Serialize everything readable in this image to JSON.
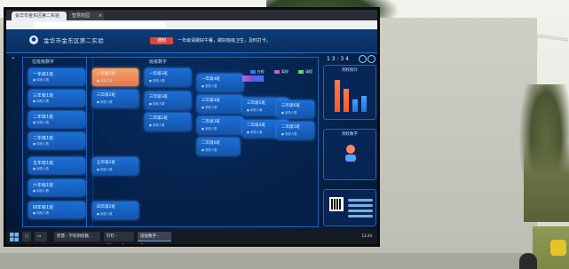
{
  "browser": {
    "tabs": [
      {
        "label": "会华市金东区第二实验学校"
      },
      {
        "label": "智慧校园"
      }
    ]
  },
  "dashboard": {
    "school_name": "金华市金东区第二实验",
    "notice_badge": "通知",
    "notice_text": "一年级请做好午餐，做好班级卫生，及时打卡。",
    "left_panel_title": "在班级数字",
    "center_panel_title": "班级数字",
    "legend": [
      {
        "label": "在校",
        "color": "#2b7bff"
      },
      {
        "label": "离校",
        "color": "#c65fd6"
      },
      {
        "label": "请假",
        "color": "#5fd67a"
      }
    ],
    "time_readout": "1 3 : 3 4",
    "stats_title": "到校统计",
    "rate_title": "到校数字",
    "left_tiles": [
      {
        "title": "一年级1班",
        "sub": "● 到校人数"
      },
      {
        "title": "三年级1班",
        "sub": "● 到校人数"
      },
      {
        "title": "二年级1班",
        "sub": "● 到校人数"
      },
      {
        "title": "二年级1班",
        "sub": "● 到校人数"
      },
      {
        "title": "五年级1班",
        "sub": "● 到校人数"
      },
      {
        "title": "六年级1班",
        "sub": "● 到校人数"
      },
      {
        "title": "四年级1班",
        "sub": "● 到校人数"
      }
    ],
    "grid_tiles": [
      {
        "title": "一年级2班",
        "sub": "● 到校人数"
      },
      {
        "title": "一年级3班",
        "sub": "● 到校人数"
      },
      {
        "title": "一年级4班",
        "sub": "● 到校人数"
      },
      {
        "title": "三年级2班",
        "sub": "● 到校人数"
      },
      {
        "title": "三年级3班",
        "sub": "● 到校人数"
      },
      {
        "title": "三年级4班",
        "sub": "● 到校人数"
      },
      {
        "title": "三年级5班",
        "sub": "● 到校人数"
      },
      {
        "title": "三年级6班",
        "sub": "● 到校人数"
      },
      {
        "title": "二年级2班",
        "sub": "● 到校人数"
      },
      {
        "title": "二年级3班",
        "sub": "● 到校人数"
      },
      {
        "title": "二年级4班",
        "sub": "● 到校人数"
      },
      {
        "title": "二年级5班",
        "sub": "● 到校人数"
      },
      {
        "title": "二年级6班",
        "sub": "● 到校人数"
      },
      {
        "title": "五年级2班",
        "sub": "● 到校人数"
      },
      {
        "title": "四年级2班",
        "sub": "● 到校人数"
      }
    ]
  },
  "taskbar": {
    "items": [
      {
        "label": "智慧 - 学校到校数..."
      },
      {
        "label": "钉钉 - Microsoft..."
      },
      {
        "label": "班级数字 - Goo..."
      }
    ],
    "tray_text": "13:34"
  }
}
